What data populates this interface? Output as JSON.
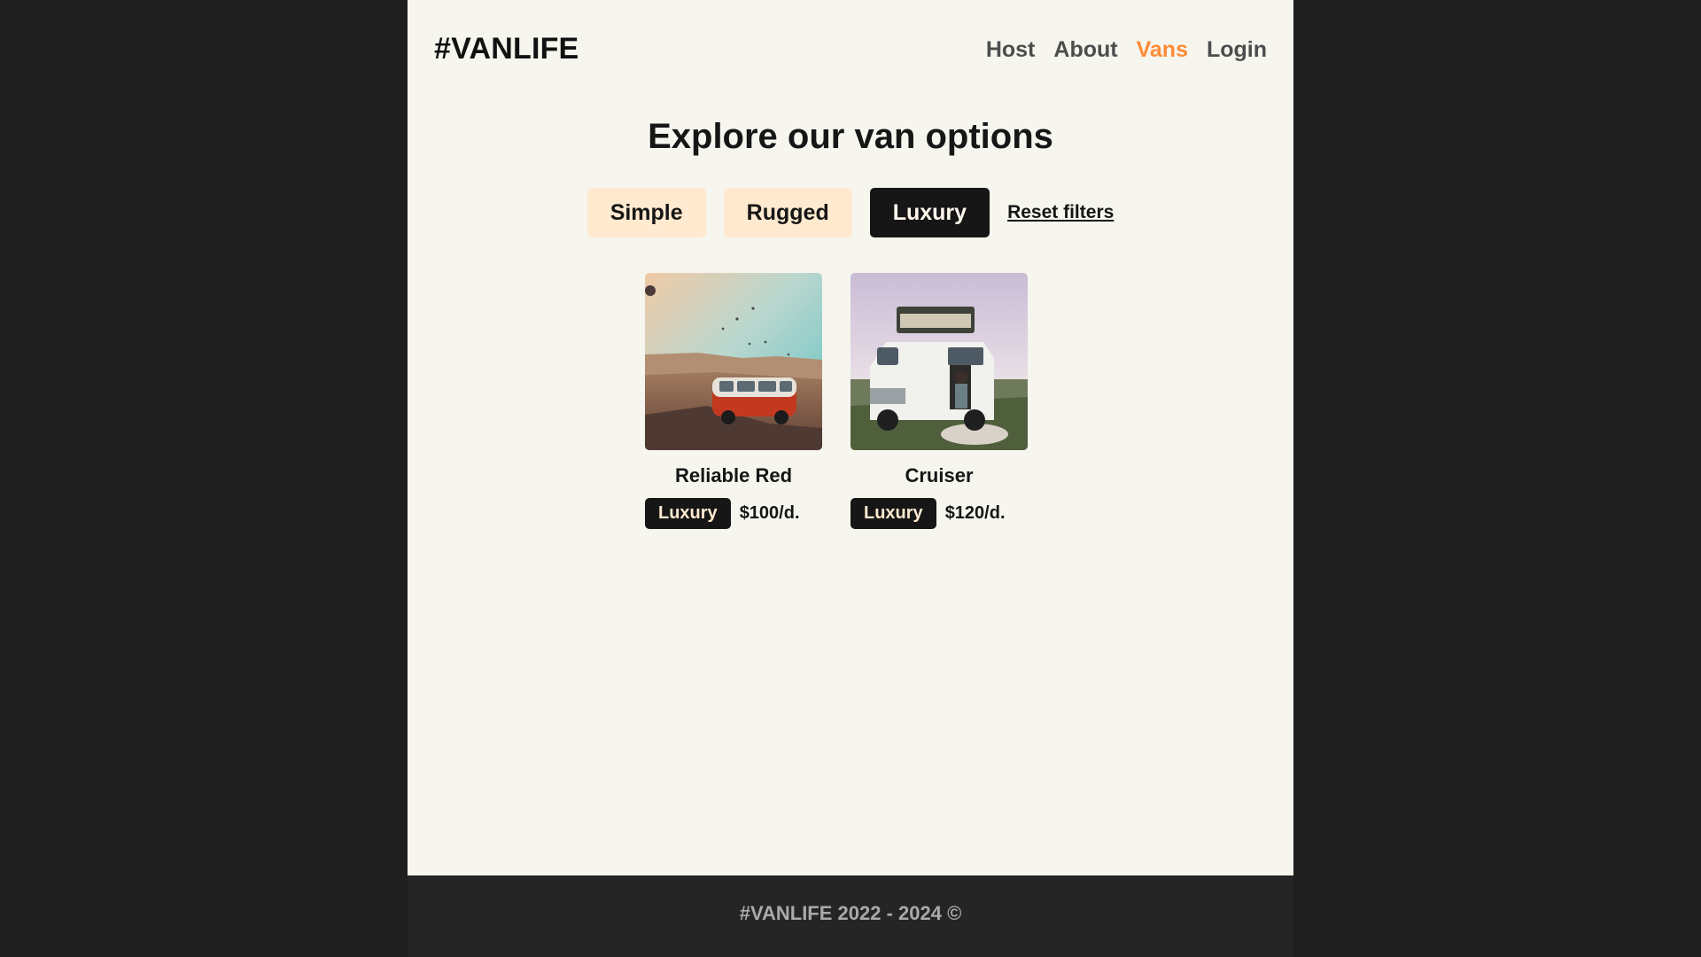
{
  "header": {
    "logo": "#VANLIFE",
    "nav": [
      {
        "label": "Host",
        "active": false
      },
      {
        "label": "About",
        "active": false
      },
      {
        "label": "Vans",
        "active": true
      },
      {
        "label": "Login",
        "active": false
      }
    ]
  },
  "main": {
    "title": "Explore our van options",
    "filters": [
      {
        "label": "Simple",
        "selected": false
      },
      {
        "label": "Rugged",
        "selected": false
      },
      {
        "label": "Luxury",
        "selected": true
      }
    ],
    "reset_label": "Reset filters",
    "vans": [
      {
        "name": "Reliable Red",
        "type": "Luxury",
        "price": "$100/d.",
        "image": "red-van-photo"
      },
      {
        "name": "Cruiser",
        "type": "Luxury",
        "price": "$120/d.",
        "image": "white-camper-van-photo"
      }
    ]
  },
  "footer": {
    "text": "#VANLIFE 2022 - 2024 ©"
  },
  "colors": {
    "page_background": "#1f1f1f",
    "app_background": "#f6f5ee",
    "accent": "#ff8c38",
    "filter_background": "#ffead0",
    "dark": "#161616",
    "footer_background": "#252525"
  }
}
